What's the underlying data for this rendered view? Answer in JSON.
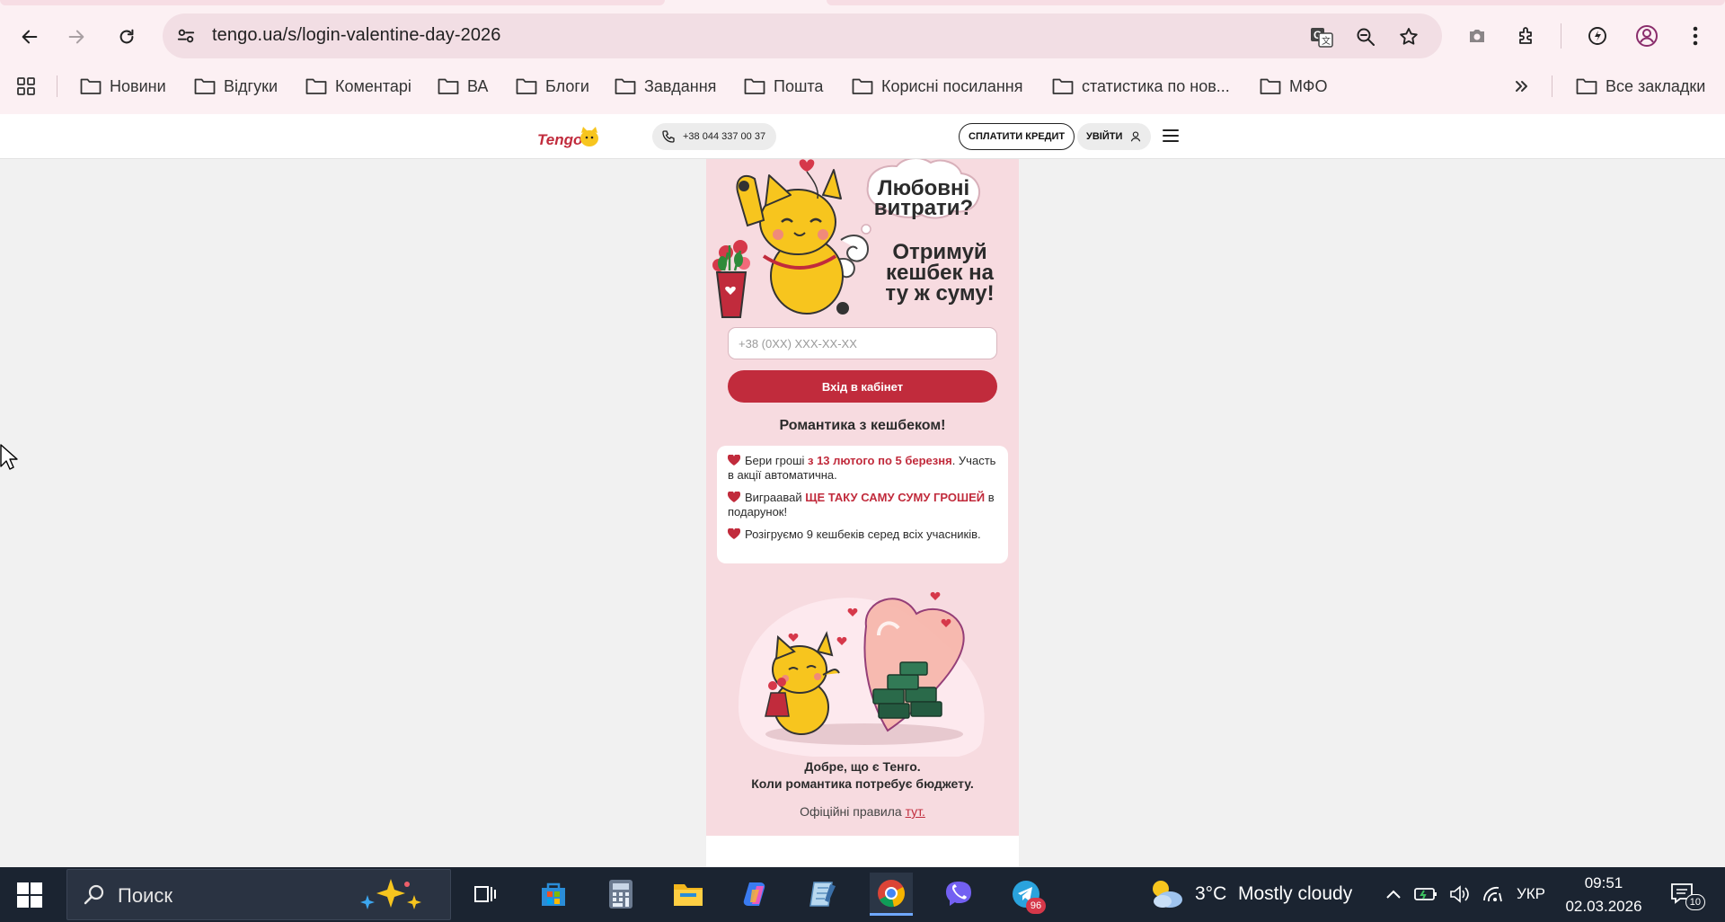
{
  "browser": {
    "url": "tengo.ua/s/login-valentine-day-2026",
    "bookmarks": [
      {
        "label": "Новини"
      },
      {
        "label": "Відгуки"
      },
      {
        "label": "Коментарі"
      },
      {
        "label": "ВА"
      },
      {
        "label": "Блоги"
      },
      {
        "label": "Завдання"
      },
      {
        "label": "Пошта"
      },
      {
        "label": "Корисні посилання"
      },
      {
        "label": "статистика по нов..."
      },
      {
        "label": "МФО"
      }
    ],
    "all_bookmarks": "Все закладки"
  },
  "site": {
    "logo_text": "Tengo",
    "phone": "+38 044 337 00 37",
    "pay_credit": "СПЛАТИТИ КРЕДИТ",
    "login": "УВІЙТИ"
  },
  "promo": {
    "bubble": "Любовні витрати?",
    "headline": "Отримуй кешбек на ту ж суму!",
    "phone_placeholder": "+38 (0XX) XXX-XX-XX",
    "cabinet_button": "Вхід в кабінет",
    "romance_title": "Романтика з кешбеком!",
    "rules": [
      {
        "before": "Бери гроші ",
        "highlight": "з 13 лютого по 5 березня",
        "after": ". Участь в акції автоматична."
      },
      {
        "before": "Виграавай ",
        "highlight": "ЩЕ ТАКУ САМУ СУМУ ГРОШЕЙ",
        "after": " в подарунок!"
      },
      {
        "before": "Розігруємо 9 кешбеків серед всіх учасників.",
        "highlight": "",
        "after": ""
      }
    ],
    "tagline_1": "Добре, що є Тенго.",
    "tagline_2": "Коли романтика потребує бюджету.",
    "official_prefix": "Офіційні правила ",
    "official_link": "тут."
  },
  "taskbar": {
    "search_label": "Поиск",
    "telegram_badge": "96",
    "weather_temp": "3°C",
    "weather_desc": "Mostly cloudy",
    "language": "УКР",
    "time": "09:51",
    "date": "02.03.2026",
    "notifications": "10"
  },
  "colors": {
    "accent": "#c12b3c",
    "promo_bg": "#f7dbe0",
    "chrome_bg": "#fcf0f3",
    "taskbar_bg": "#1b2431",
    "brand_yellow": "#f7c51e"
  }
}
